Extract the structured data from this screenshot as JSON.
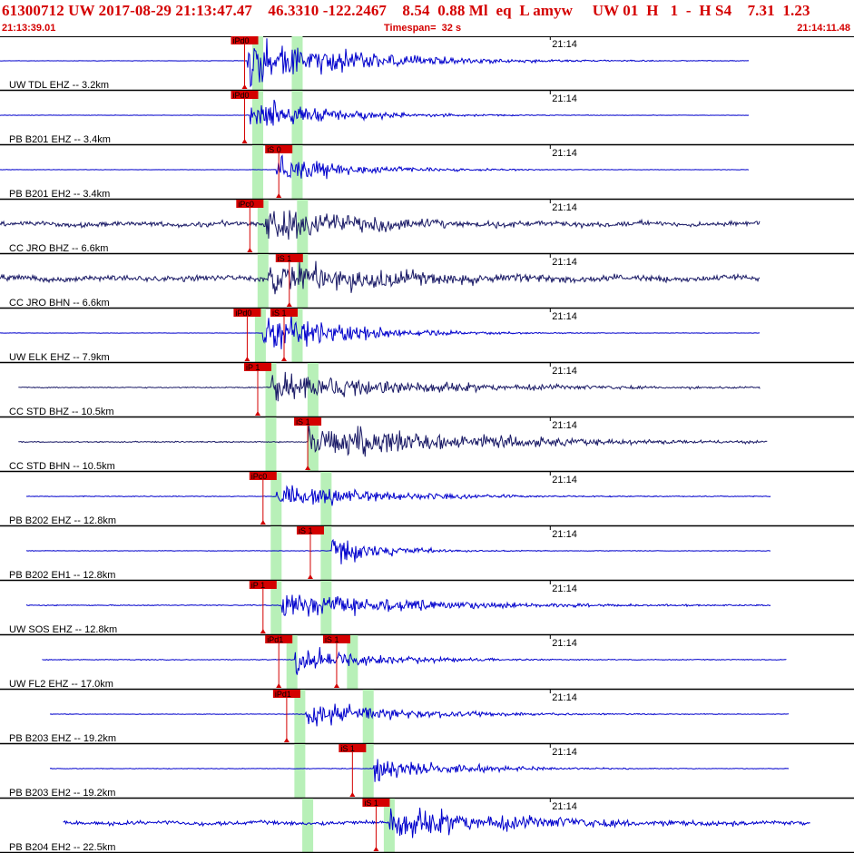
{
  "header": {
    "event_line": "61300712 UW 2017-08-29 21:13:47.47    46.3310 -122.2467    8.54  0.88 Ml  eq  L amyw     UW 01  H   1  -  H S4    7.31  1.23",
    "start_time": "21:13:39.01",
    "timespan": "Timespan=  32 s",
    "end_time": "21:14:11.48"
  },
  "minute_label": "21:14",
  "colors": {
    "accent_red": "#d40000",
    "trace_blue": "#0000cc",
    "trace_navy": "#1a1a66",
    "window_green": "#b8f0b8",
    "divider": "#000000"
  },
  "traces": [
    {
      "label": "UW TDL EHZ -- 3.2km",
      "start_s": 0,
      "end_s": 28.5,
      "color": "navy_blue",
      "noise": 0.02,
      "picks": [
        {
          "code": "iPd0",
          "t": 9.3
        }
      ],
      "windows": [
        {
          "t": 9.8
        },
        {
          "t": 11.3
        }
      ],
      "onset_t": 9.4,
      "amp": 1.0,
      "decay": 4
    },
    {
      "label": "PB B201 EHZ -- 3.4km",
      "start_s": 0,
      "end_s": 28.5,
      "color": "navy_blue",
      "noise": 0.02,
      "picks": [
        {
          "code": "iPd0",
          "t": 9.3
        }
      ],
      "windows": [
        {
          "t": 9.8
        },
        {
          "t": 11.3
        }
      ],
      "onset_t": 9.5,
      "amp": 0.7,
      "decay": 3
    },
    {
      "label": "PB B201 EH2 -- 3.4km",
      "start_s": 0,
      "end_s": 28.5,
      "color": "navy_blue",
      "noise": 0.02,
      "picks": [
        {
          "code": "iS 0",
          "t": 10.6
        }
      ],
      "windows": [
        {
          "t": 9.8
        },
        {
          "t": 11.3
        }
      ],
      "onset_t": 10.5,
      "amp": 0.6,
      "decay": 3
    },
    {
      "label": "CC JRO BHZ -- 6.6km",
      "start_s": 0,
      "end_s": 28.9,
      "color": "navy",
      "noise": 0.25,
      "picks": [
        {
          "code": "iPc0",
          "t": 9.5
        }
      ],
      "windows": [
        {
          "t": 10.0
        },
        {
          "t": 11.5
        }
      ],
      "onset_t": 10.0,
      "amp": 0.8,
      "decay": 4
    },
    {
      "label": "CC JRO BHN -- 6.6km",
      "start_s": 0,
      "end_s": 28.9,
      "color": "navy",
      "noise": 0.3,
      "picks": [
        {
          "code": "iS 1",
          "t": 11.0
        }
      ],
      "windows": [
        {
          "t": 10.0
        },
        {
          "t": 11.5
        }
      ],
      "onset_t": 10.2,
      "amp": 0.8,
      "decay": 5
    },
    {
      "label": "UW ELK EHZ -- 7.9km",
      "start_s": 0,
      "end_s": 28.9,
      "color": "navy_blue",
      "noise": 0.02,
      "picks": [
        {
          "code": "iPd0",
          "t": 9.4
        },
        {
          "code": "iS 1",
          "t": 10.8
        }
      ],
      "windows": [
        {
          "t": 9.9
        },
        {
          "t": 11.3
        }
      ],
      "onset_t": 10.0,
      "amp": 0.9,
      "decay": 3
    },
    {
      "label": "CC STD BHZ -- 10.5km",
      "start_s": 0.7,
      "end_s": 28.9,
      "color": "navy",
      "noise": 0.06,
      "picks": [
        {
          "code": "iP 1",
          "t": 9.8
        }
      ],
      "windows": [
        {
          "t": 10.3
        },
        {
          "t": 11.9
        }
      ],
      "onset_t": 10.3,
      "amp": 0.6,
      "decay": 6
    },
    {
      "label": "CC STD BHN -- 10.5km",
      "start_s": 0.7,
      "end_s": 29.2,
      "color": "navy",
      "noise": 0.06,
      "picks": [
        {
          "code": "iS 1",
          "t": 11.7
        }
      ],
      "windows": [
        {
          "t": 10.3
        },
        {
          "t": 11.9
        }
      ],
      "onset_t": 11.7,
      "amp": 0.8,
      "decay": 6
    },
    {
      "label": "PB B202 EHZ -- 12.8km",
      "start_s": 1.0,
      "end_s": 29.3,
      "color": "navy_blue",
      "noise": 0.04,
      "picks": [
        {
          "code": "iPc0",
          "t": 10.0
        }
      ],
      "windows": [
        {
          "t": 10.5
        },
        {
          "t": 12.4
        }
      ],
      "onset_t": 10.5,
      "amp": 0.5,
      "decay": 4
    },
    {
      "label": "PB B202 EH1 -- 12.8km",
      "start_s": 1.0,
      "end_s": 29.3,
      "color": "navy_blue",
      "noise": 0.03,
      "picks": [
        {
          "code": "iS 1",
          "t": 11.8
        }
      ],
      "windows": [
        {
          "t": 10.5
        },
        {
          "t": 12.4
        }
      ],
      "onset_t": 12.6,
      "amp": 0.6,
      "decay": 2
    },
    {
      "label": "UW SOS EHZ -- 12.8km",
      "start_s": 1.0,
      "end_s": 29.3,
      "color": "navy_blue",
      "noise": 0.05,
      "picks": [
        {
          "code": "iP 1",
          "t": 10.0
        }
      ],
      "windows": [
        {
          "t": 10.5
        },
        {
          "t": 12.4
        }
      ],
      "onset_t": 10.7,
      "amp": 0.6,
      "decay": 5
    },
    {
      "label": "UW FL2 EHZ -- 17.0km",
      "start_s": 1.6,
      "end_s": 29.9,
      "color": "navy_blue",
      "noise": 0.04,
      "picks": [
        {
          "code": "iPd1",
          "t": 10.6
        },
        {
          "code": "iS 1",
          "t": 12.8
        }
      ],
      "windows": [
        {
          "t": 11.1
        },
        {
          "t": 13.4
        }
      ],
      "onset_t": 11.2,
      "amp": 0.6,
      "decay": 3
    },
    {
      "label": "PB B203 EHZ -- 19.2km",
      "start_s": 1.9,
      "end_s": 30.0,
      "color": "navy_blue",
      "noise": 0.03,
      "picks": [
        {
          "code": "iPd1",
          "t": 10.9
        }
      ],
      "windows": [
        {
          "t": 11.4
        },
        {
          "t": 14.0
        }
      ],
      "onset_t": 11.6,
      "amp": 0.5,
      "decay": 4
    },
    {
      "label": "PB B203 EH2 -- 19.2km",
      "start_s": 1.9,
      "end_s": 30.0,
      "color": "navy_blue",
      "noise": 0.03,
      "picks": [
        {
          "code": "iS 1",
          "t": 13.4
        }
      ],
      "windows": [
        {
          "t": 11.4
        },
        {
          "t": 14.0
        }
      ],
      "onset_t": 14.2,
      "amp": 0.5,
      "decay": 3
    },
    {
      "label": "PB B204 EH2 -- 22.5km",
      "start_s": 2.4,
      "end_s": 30.8,
      "color": "navy_blue",
      "noise": 0.2,
      "picks": [
        {
          "code": "iS 1",
          "t": 14.3
        }
      ],
      "windows": [
        {
          "t": 11.7
        },
        {
          "t": 14.8
        }
      ],
      "onset_t": 14.8,
      "amp": 0.7,
      "decay": 5
    }
  ]
}
